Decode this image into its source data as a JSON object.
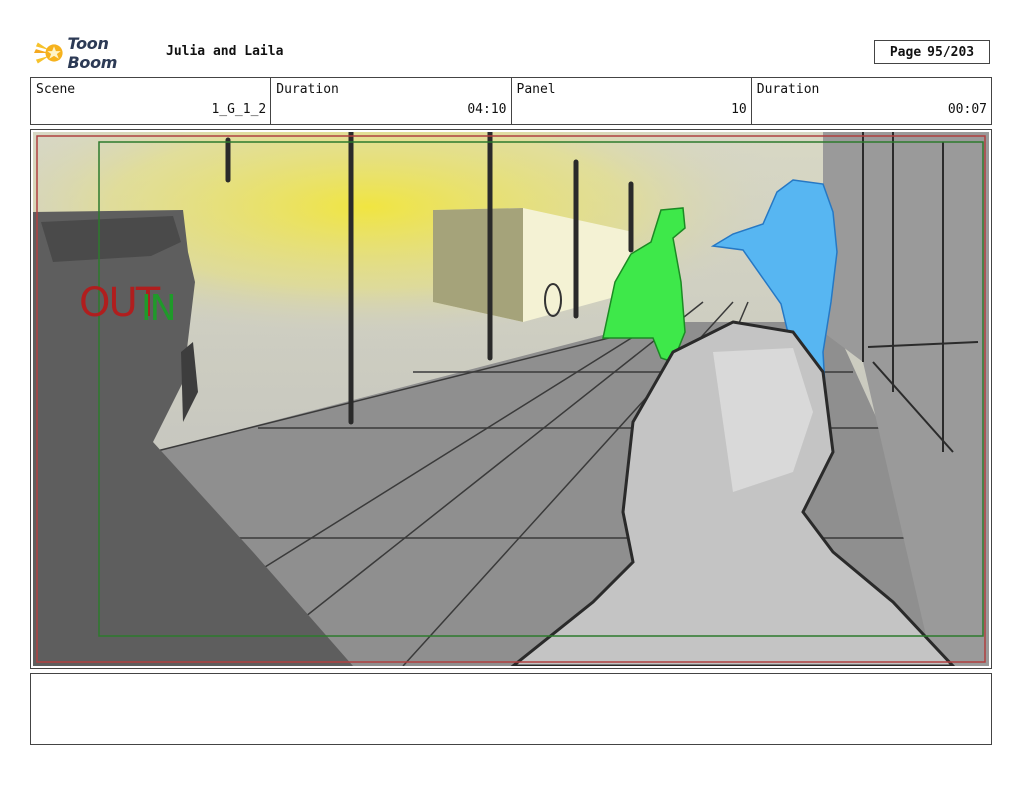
{
  "header": {
    "logo_text": "Toon Boom",
    "title": "Julia and Laila",
    "page_label": "Page",
    "page_value": "95/203"
  },
  "info": [
    {
      "label": "Scene",
      "value": "1_G_1_2"
    },
    {
      "label": "Duration",
      "value": "04:10"
    },
    {
      "label": "Panel",
      "value": "10"
    },
    {
      "label": "Duration",
      "value": "00:07"
    }
  ],
  "panel": {
    "out_label": "OUT",
    "in_label": "IN",
    "out_color": "#b01e1e",
    "in_color": "#1f9a2a"
  },
  "notes": ""
}
